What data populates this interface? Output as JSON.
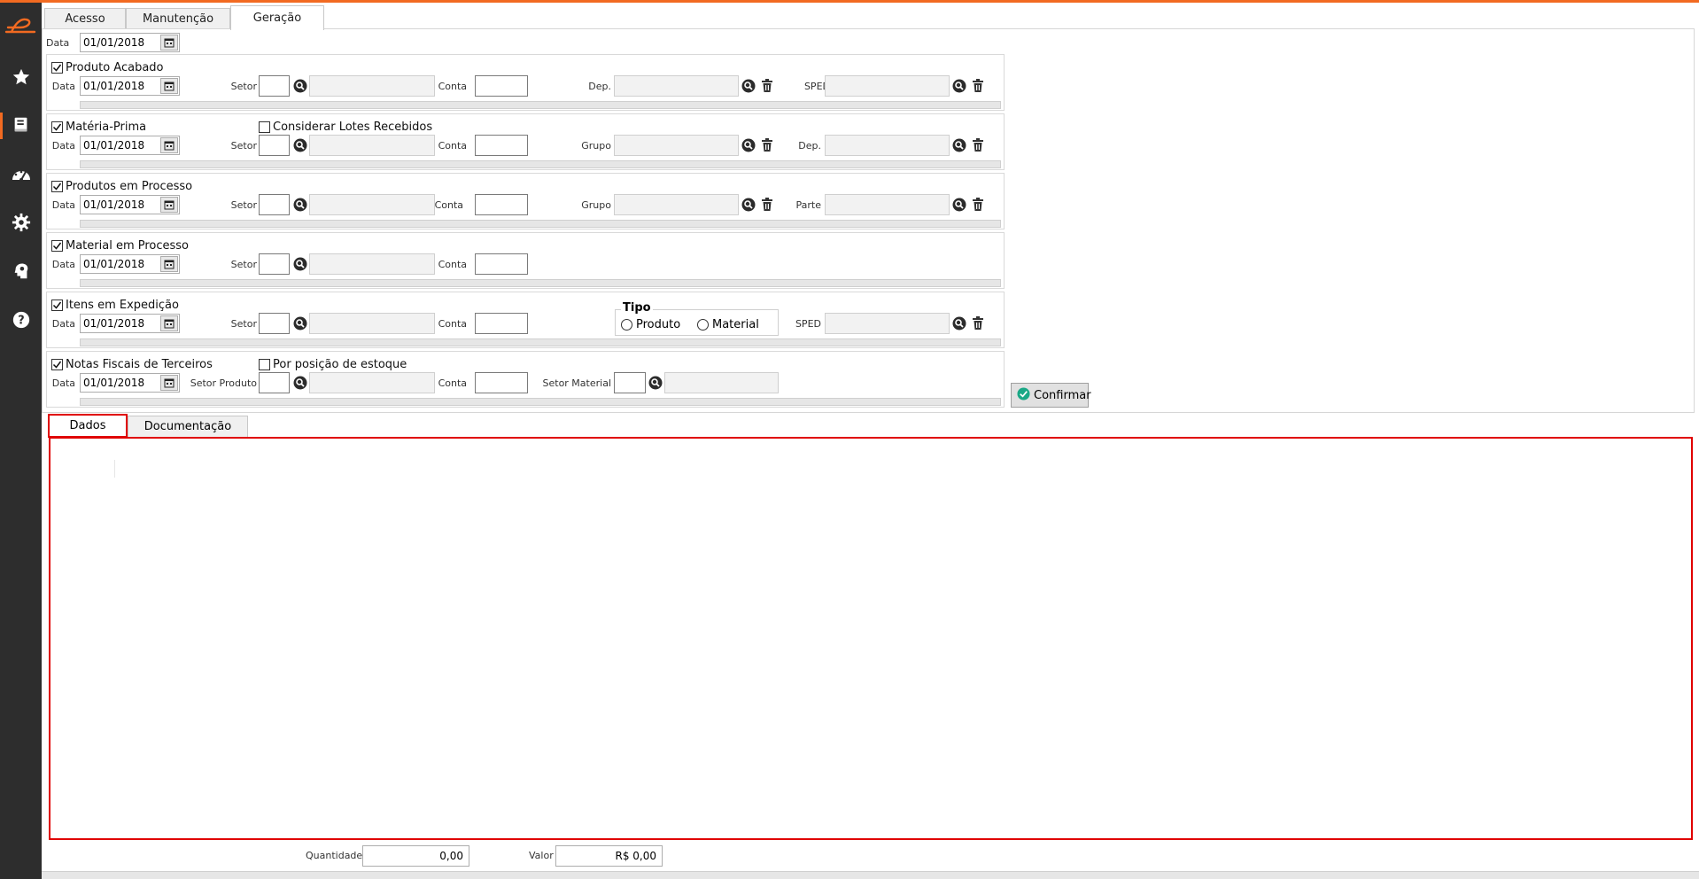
{
  "tabs": [
    "Acesso",
    "Manutenção",
    "Geração"
  ],
  "active_tab": "Geração",
  "top_date": {
    "label": "Data",
    "value": "01/01/2018"
  },
  "sections": {
    "produto_acabado": {
      "checkbox": "Produto Acabado",
      "checked": true,
      "data_label": "Data",
      "date": "01/01/2018",
      "setor_label": "Setor",
      "conta_label": "Conta",
      "dep_label": "Dep.",
      "sped_label": "SPED"
    },
    "materia_prima": {
      "checkbox": "Matéria-Prima",
      "checked": true,
      "extra_checkbox": "Considerar Lotes Recebidos",
      "extra_checked": false,
      "data_label": "Data",
      "date": "01/01/2018",
      "setor_label": "Setor",
      "conta_label": "Conta",
      "grupo_label": "Grupo",
      "dep_label": "Dep."
    },
    "produtos_processo": {
      "checkbox": "Produtos em Processo",
      "checked": true,
      "data_label": "Data",
      "date": "01/01/2018",
      "setor_label": "Setor",
      "conta_label": "Conta",
      "grupo_label": "Grupo",
      "parte_label": "Parte"
    },
    "material_processo": {
      "checkbox": "Material em Processo",
      "checked": true,
      "data_label": "Data",
      "date": "01/01/2018",
      "setor_label": "Setor",
      "conta_label": "Conta"
    },
    "itens_expedicao": {
      "checkbox": "Itens em Expedição",
      "checked": true,
      "data_label": "Data",
      "date": "01/01/2018",
      "setor_label": "Setor",
      "conta_label": "Conta",
      "tipo_title": "Tipo",
      "tipo_options": [
        "Produto",
        "Material"
      ],
      "sped_label": "SPED"
    },
    "notas_fiscais": {
      "checkbox": "Notas Fiscais de Terceiros",
      "checked": true,
      "extra_checkbox": "Por posição de estoque",
      "extra_checked": false,
      "data_label": "Data",
      "date": "01/01/2018",
      "setor_produto_label": "Setor Produto",
      "conta_label": "Conta",
      "setor_material_label": "Setor Material"
    }
  },
  "confirm_button": "Confirmar",
  "bottom_tabs": [
    "Dados",
    "Documentação"
  ],
  "active_bottom_tab": "Dados",
  "footer": {
    "quantidade_label": "Quantidade",
    "quantidade_value": "0,00",
    "valor_label": "Valor",
    "valor_value": "R$ 0,00"
  },
  "colors": {
    "accent": "#f26a21",
    "sidebar": "#2d2d2d",
    "highlight": "#e00000"
  }
}
